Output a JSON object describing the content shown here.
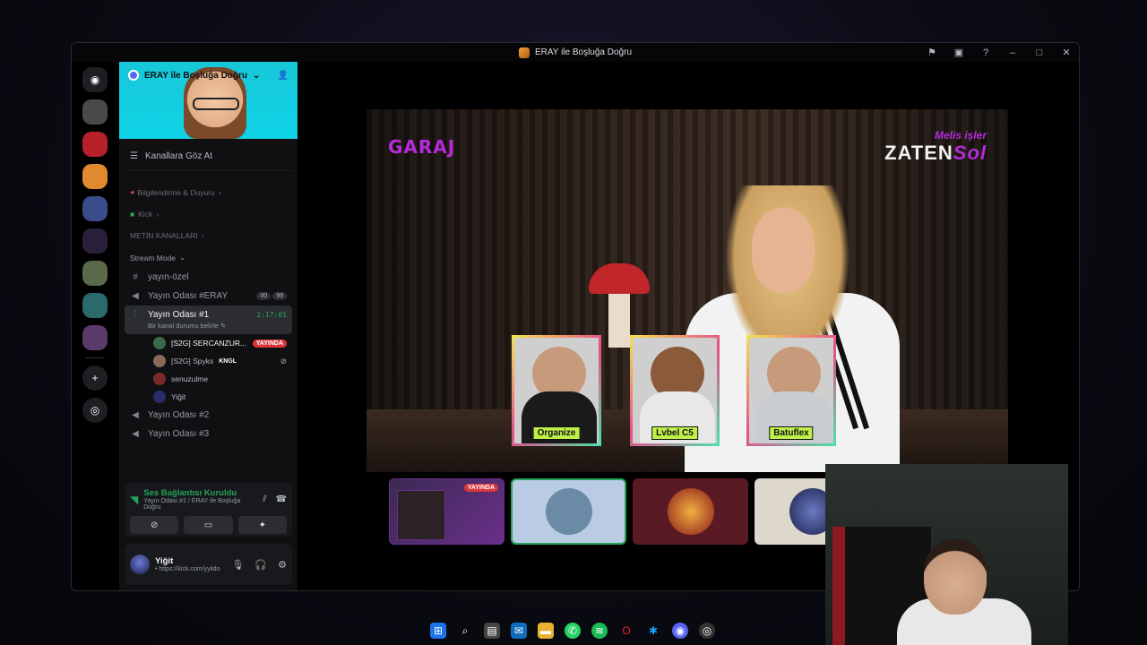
{
  "window": {
    "title": "ERAY ile Boşluğa Doğru"
  },
  "server": {
    "name": "ERAY ile Boşluğa Doğru",
    "browse_label": "Kanallara Göz At"
  },
  "categories": {
    "info": "Bilgilendirme & Duyuru",
    "kick": "Kick",
    "metin": "METİN KANALLARI",
    "stream_mode": "Stream Mode"
  },
  "channels": {
    "yayin_ozel": "yayın-özel",
    "yayin_eray": "Yayın Odası #ERAY",
    "yayin_eray_counts": [
      "00",
      "99"
    ],
    "yayin_1": "Yayın Odası #1",
    "yayin_1_timer": "1:17:01",
    "yayin_1_status": "Bir kanal durumu belirle",
    "yayin_2": "Yayın Odası #2",
    "yayin_3": "Yayın Odası #3"
  },
  "voice_users": [
    {
      "name": "[S2G] SERCANZUR...",
      "badge": "YAYINDA"
    },
    {
      "name": "[S2G] Spyks",
      "tag": "KNGL"
    },
    {
      "name": "senuzulme"
    },
    {
      "name": "Yiğit"
    }
  ],
  "voice_panel": {
    "title": "Ses Bağlantısı Kuruldu",
    "subtitle": "Yayın Odası #1 / ERAY ile Boşluğa Doğru"
  },
  "user_panel": {
    "name": "Yiğit",
    "status": "• https://kick.com/yyiido"
  },
  "stream": {
    "logo_left": "GARAJ",
    "logo_right_top": "Melis işler",
    "logo_right_main": "ZATEN",
    "logo_right_accent": "Sol",
    "guests": [
      "Organize",
      "Lvbel C5",
      "Batuflex"
    ]
  },
  "thumb_live_label": "YAYINDA",
  "colors": {
    "accent_green": "#23a55a",
    "live_red": "#da373c",
    "brand_purple": "#b62bd9",
    "name_tag": "#bff04a"
  }
}
